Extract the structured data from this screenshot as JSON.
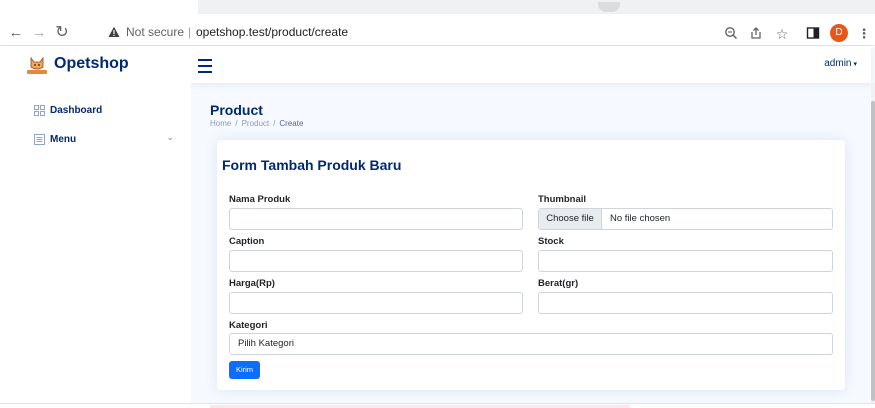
{
  "browser": {
    "security_label": "Not secure",
    "separator": "|",
    "url": "opetshop.test/product/create",
    "profile_initial": "D",
    "icons": {
      "back": "arrow-left-icon",
      "forward": "arrow-right-icon",
      "reload": "reload-icon",
      "warning": "warning-triangle-icon",
      "zoom": "zoom-icon",
      "share": "share-icon",
      "bookmark": "star-icon",
      "side_panel": "side-panel-icon",
      "menu": "kebab-menu-icon"
    },
    "colors": {
      "profile": "#e8561a"
    }
  },
  "app": {
    "brand": "Opetshop",
    "user": "admin",
    "colors": {
      "primary_text": "#012970",
      "accent": "#0d6efd",
      "page_bg": "#f6f9ff"
    }
  },
  "sidebar": {
    "items": [
      {
        "label": "Dashboard",
        "icon": "grid-icon"
      },
      {
        "label": "Menu",
        "icon": "list-icon",
        "expandable": true
      }
    ]
  },
  "page": {
    "title": "Product",
    "breadcrumb": [
      "Home",
      "Product",
      "Create"
    ]
  },
  "form": {
    "title": "Form Tambah Produk Baru",
    "fields": {
      "nama_produk": {
        "label": "Nama Produk",
        "value": ""
      },
      "thumbnail": {
        "label": "Thumbnail",
        "button": "Choose file",
        "status": "No file chosen"
      },
      "caption": {
        "label": "Caption",
        "value": ""
      },
      "stock": {
        "label": "Stock",
        "value": ""
      },
      "harga": {
        "label": "Harga(Rp)",
        "value": ""
      },
      "berat": {
        "label": "Berat(gr)",
        "value": ""
      },
      "kategori": {
        "label": "Kategori",
        "selected": "Pilih Kategori"
      }
    },
    "submit_label": "Kirim"
  }
}
